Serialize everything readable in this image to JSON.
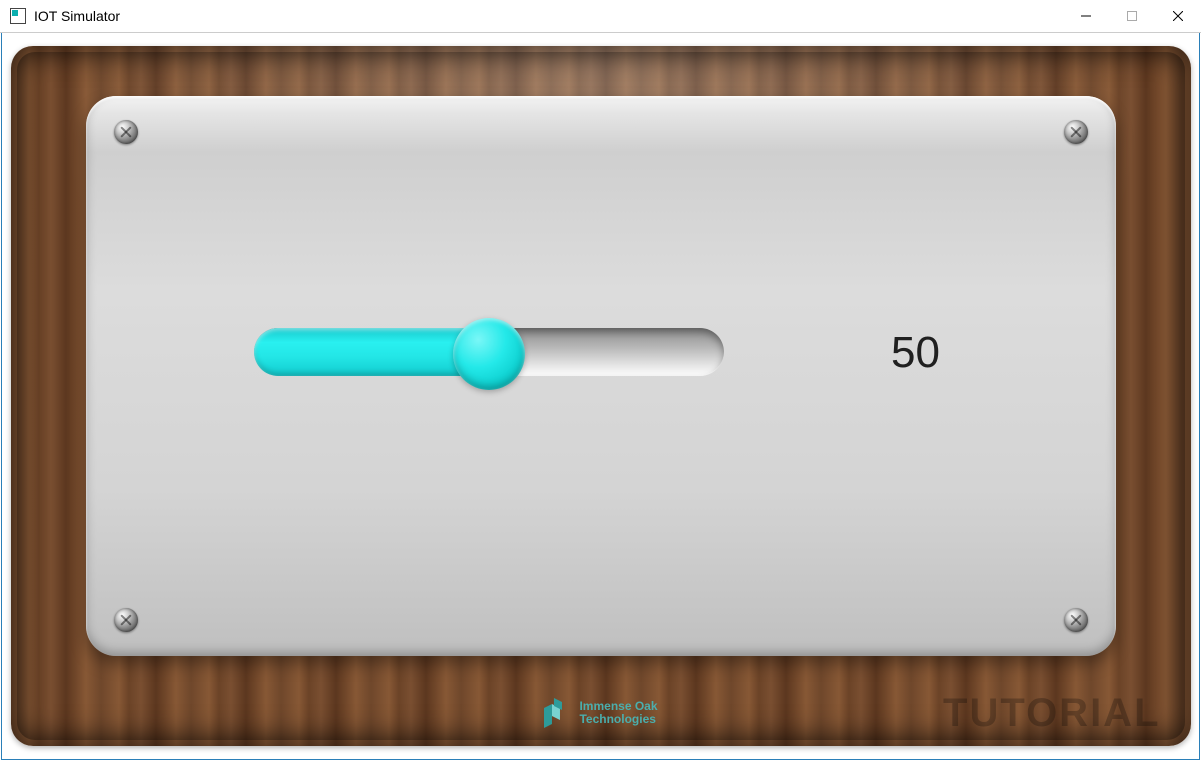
{
  "window": {
    "title": "IOT Simulator"
  },
  "slider": {
    "value": 50,
    "min": 0,
    "max": 100
  },
  "display": {
    "value_text": "50"
  },
  "footer": {
    "brand_line1": "Immense Oak",
    "brand_line2": "Technologies",
    "watermark": "TUTORIAL"
  },
  "colors": {
    "accent": "#24e9e9",
    "wood_dark": "#5a381f",
    "wood_light": "#8a5a36",
    "panel": "#d8d8d8"
  }
}
